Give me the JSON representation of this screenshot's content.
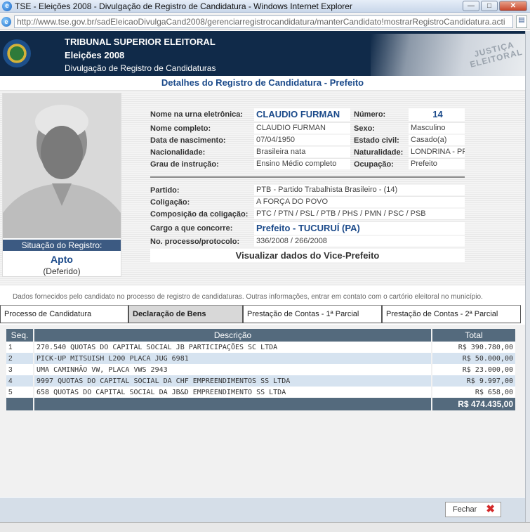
{
  "window": {
    "title": "TSE - Eleições 2008 - Divulgação de Registro de Candidatura - Windows Internet Explorer",
    "url": "http://www.tse.gov.br/sadEleicaoDivulgaCand2008/gerenciarregistrocandidatura/manterCandidato!mostrarRegistroCandidatura.acti"
  },
  "header": {
    "line1": "TRIBUNAL SUPERIOR ELEITORAL",
    "line2": "Eleições 2008",
    "line3": "Divulgação de Registro de Candidaturas",
    "stamp": "JUSTIÇA ELEITORAL"
  },
  "section_title": "Detalhes do Registro de Candidatura - Prefeito",
  "status": {
    "label": "Situação do Registro:",
    "value": "Apto",
    "sub": "(Deferido)"
  },
  "fields": {
    "urna_label": "Nome na urna eletrônica:",
    "urna_value": "CLAUDIO FURMAN",
    "numero_label": "Número:",
    "numero_value": "14",
    "nome_label": "Nome completo:",
    "nome_value": "CLAUDIO FURMAN",
    "sexo_label": "Sexo:",
    "sexo_value": "Masculino",
    "nasc_label": "Data de nascimento:",
    "nasc_value": "07/04/1950",
    "civil_label": "Estado civil:",
    "civil_value": "Casado(a)",
    "nac_label": "Nacionalidade:",
    "nac_value": "Brasileira nata",
    "natur_label": "Naturalidade:",
    "natur_value": "LONDRINA - PR",
    "grau_label": "Grau de instrução:",
    "grau_value": "Ensino Médio completo",
    "ocup_label": "Ocupação:",
    "ocup_value": "Prefeito",
    "partido_label": "Partido:",
    "partido_value": "PTB - Partido Trabalhista Brasileiro - (14)",
    "colig_label": "Coligação:",
    "colig_value": "A FORÇA DO POVO",
    "comp_label": "Composição da coligação:",
    "comp_value": "PTC / PTN / PSL / PTB / PHS / PMN / PSC / PSB",
    "cargo_label": "Cargo a que concorre:",
    "cargo_value": "Prefeito - TUCURUÍ (PA)",
    "proc_label": "No. processo/protocolo:",
    "proc_value": "336/2008 / 266/2008",
    "vice_link": "Visualizar dados do Vice-Prefeito"
  },
  "note": "Dados fornecidos pelo candidato no processo de registro de candidaturas. Outras informações, entrar em contato com o cartório eleitoral no município.",
  "tabs": [
    {
      "label": "Processo de Candidatura"
    },
    {
      "label": "Declaração de Bens"
    },
    {
      "label": "Prestação de Contas - 1ª Parcial"
    },
    {
      "label": "Prestação de Contas - 2ª Parcial"
    }
  ],
  "table": {
    "headers": [
      "Seq.",
      "Descrição",
      "Total"
    ],
    "rows": [
      {
        "seq": "1",
        "desc": "270.540 QUOTAS DO CAPITAL SOCIAL JB PARTICIPAÇÕES SC LTDA",
        "total": "R$ 390.780,00"
      },
      {
        "seq": "2",
        "desc": "PICK-UP MITSUISH L200 PLACA JUG 6981",
        "total": "R$ 50.000,00"
      },
      {
        "seq": "3",
        "desc": "UMA CAMINHÃO VW, PLACA VWS 2943",
        "total": "R$ 23.000,00"
      },
      {
        "seq": "4",
        "desc": "9997 QUOTAS DO CAPITAL SOCIAL DA CHF EMPREENDIMENTOS SS LTDA",
        "total": "R$ 9.997,00"
      },
      {
        "seq": "5",
        "desc": "658 QUOTAS DO CAPITAL SOCIAL DA JB&D EMPREENDIMENTO SS LTDA",
        "total": "R$ 658,00"
      }
    ],
    "sum": "R$ 474.435,00"
  },
  "footer": {
    "close_label": "Fechar"
  },
  "colors": {
    "banner": "#102a49",
    "accent_blue": "#1b4a8a",
    "table_header": "#546a7d",
    "row_alt": "#d6e3f0",
    "close_x": "#d42a2a"
  }
}
